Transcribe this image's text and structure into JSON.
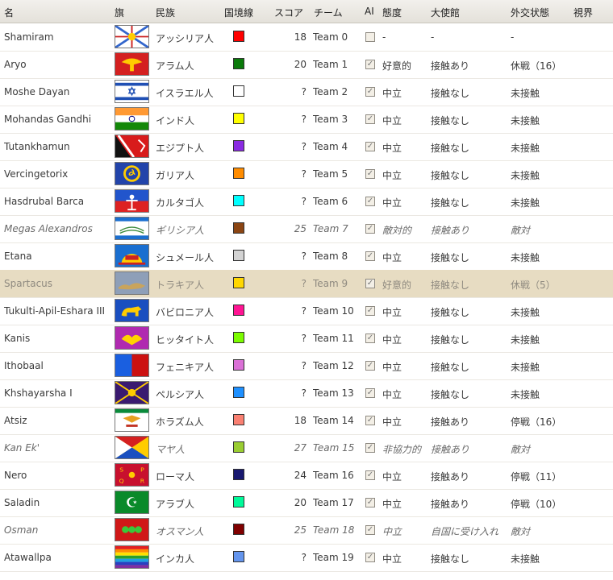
{
  "headers": {
    "name": "名",
    "flag": "旗",
    "nation": "民族",
    "border": "国境線",
    "score": "スコア",
    "team": "チーム",
    "ai": "AI",
    "attitude": "態度",
    "embassy": "大使館",
    "diplomacy": "外交状態",
    "vision": "視界"
  },
  "rows": [
    {
      "name": "Shamiram",
      "nation": "アッシリア人",
      "border_color": "#ff0000",
      "score": "18",
      "team": "Team 0",
      "ai_checked": false,
      "attitude": "-",
      "embassy": "-",
      "diplomacy": "-",
      "flag": "assyria"
    },
    {
      "name": "Aryo",
      "nation": "アラム人",
      "border_color": "#0a7a0a",
      "score": "20",
      "team": "Team 1",
      "ai_checked": true,
      "attitude": "好意的",
      "embassy": "接触あり",
      "diplomacy": "休戦（16）",
      "flag": "aram"
    },
    {
      "name": "Moshe Dayan",
      "nation": "イスラエル人",
      "border_color": "#ffffff",
      "score": "?",
      "team": "Team 2",
      "ai_checked": true,
      "attitude": "中立",
      "embassy": "接触なし",
      "diplomacy": "未接触",
      "flag": "israel"
    },
    {
      "name": "Mohandas Gandhi",
      "nation": "インド人",
      "border_color": "#ffff00",
      "score": "?",
      "team": "Team 3",
      "ai_checked": true,
      "attitude": "中立",
      "embassy": "接触なし",
      "diplomacy": "未接触",
      "flag": "india"
    },
    {
      "name": "Tutankhamun",
      "nation": "エジプト人",
      "border_color": "#8a2be2",
      "score": "?",
      "team": "Team 4",
      "ai_checked": true,
      "attitude": "中立",
      "embassy": "接触なし",
      "diplomacy": "未接触",
      "flag": "egypt"
    },
    {
      "name": "Vercingetorix",
      "nation": "ガリア人",
      "border_color": "#ff8c00",
      "score": "?",
      "team": "Team 5",
      "ai_checked": true,
      "attitude": "中立",
      "embassy": "接触なし",
      "diplomacy": "未接触",
      "flag": "gaul"
    },
    {
      "name": "Hasdrubal Barca",
      "nation": "カルタゴ人",
      "border_color": "#00ffff",
      "score": "?",
      "team": "Team 6",
      "ai_checked": true,
      "attitude": "中立",
      "embassy": "接触なし",
      "diplomacy": "未接触",
      "flag": "carthage"
    },
    {
      "name": "Megas Alexandros",
      "nation": "ギリシア人",
      "border_color": "#8b4513",
      "score": "25",
      "team": "Team 7",
      "ai_checked": true,
      "attitude": "敵対的",
      "embassy": "接触あり",
      "diplomacy": "敵対",
      "flag": "greece",
      "italic": true
    },
    {
      "name": "Etana",
      "nation": "シュメール人",
      "border_color": "#d3d3d3",
      "score": "?",
      "team": "Team 8",
      "ai_checked": true,
      "attitude": "中立",
      "embassy": "接触なし",
      "diplomacy": "未接触",
      "flag": "sumer"
    },
    {
      "name": "Spartacus",
      "nation": "トラキア人",
      "border_color": "#ffd700",
      "score": "?",
      "team": "Team 9",
      "ai_checked": true,
      "attitude": "好意的",
      "embassy": "接触なし",
      "diplomacy": "休戦（5）",
      "flag": "thrace",
      "selected": true
    },
    {
      "name": "Tukulti-Apil-Eshara III",
      "nation": "バビロニア人",
      "border_color": "#ff1493",
      "score": "?",
      "team": "Team 10",
      "ai_checked": true,
      "attitude": "中立",
      "embassy": "接触なし",
      "diplomacy": "未接触",
      "flag": "babylon"
    },
    {
      "name": "Kanis",
      "nation": "ヒッタイト人",
      "border_color": "#7cfc00",
      "score": "?",
      "team": "Team 11",
      "ai_checked": true,
      "attitude": "中立",
      "embassy": "接触なし",
      "diplomacy": "未接触",
      "flag": "hittite"
    },
    {
      "name": "Ithobaal",
      "nation": "フェニキア人",
      "border_color": "#da70d6",
      "score": "?",
      "team": "Team 12",
      "ai_checked": true,
      "attitude": "中立",
      "embassy": "接触なし",
      "diplomacy": "未接触",
      "flag": "phoenicia"
    },
    {
      "name": "Khshayarsha I",
      "nation": "ペルシア人",
      "border_color": "#1e90ff",
      "score": "?",
      "team": "Team 13",
      "ai_checked": true,
      "attitude": "中立",
      "embassy": "接触なし",
      "diplomacy": "未接触",
      "flag": "persia"
    },
    {
      "name": "Atsiz",
      "nation": "ホラズム人",
      "border_color": "#fa8072",
      "score": "18",
      "team": "Team 14",
      "ai_checked": true,
      "attitude": "中立",
      "embassy": "接触あり",
      "diplomacy": "停戦（16）",
      "flag": "khwarezm"
    },
    {
      "name": "Kan Ek'",
      "nation": "マヤ人",
      "border_color": "#9acd32",
      "score": "27",
      "team": "Team 15",
      "ai_checked": true,
      "attitude": "非協力的",
      "embassy": "接触あり",
      "diplomacy": "敵対",
      "flag": "maya",
      "italic": true
    },
    {
      "name": "Nero",
      "nation": "ローマ人",
      "border_color": "#191970",
      "score": "24",
      "team": "Team 16",
      "ai_checked": true,
      "attitude": "中立",
      "embassy": "接触あり",
      "diplomacy": "停戦（11）",
      "flag": "rome"
    },
    {
      "name": "Saladin",
      "nation": "アラブ人",
      "border_color": "#00fa9a",
      "score": "20",
      "team": "Team 17",
      "ai_checked": true,
      "attitude": "中立",
      "embassy": "接触あり",
      "diplomacy": "停戦（10）",
      "flag": "arab"
    },
    {
      "name": "Osman",
      "nation": "オスマン人",
      "border_color": "#800000",
      "score": "25",
      "team": "Team 18",
      "ai_checked": true,
      "attitude": "中立",
      "embassy": "自国に受け入れ",
      "diplomacy": "敵対",
      "flag": "ottoman",
      "italic": true
    },
    {
      "name": "Atawallpa",
      "nation": "インカ人",
      "border_color": "#6495ed",
      "score": "?",
      "team": "Team 19",
      "ai_checked": true,
      "attitude": "中立",
      "embassy": "接触なし",
      "diplomacy": "未接触",
      "flag": "inca"
    }
  ],
  "flag_texts": {
    "rome": [
      "S",
      "P",
      "Q",
      "R"
    ],
    "arab_symbol": "☪"
  }
}
